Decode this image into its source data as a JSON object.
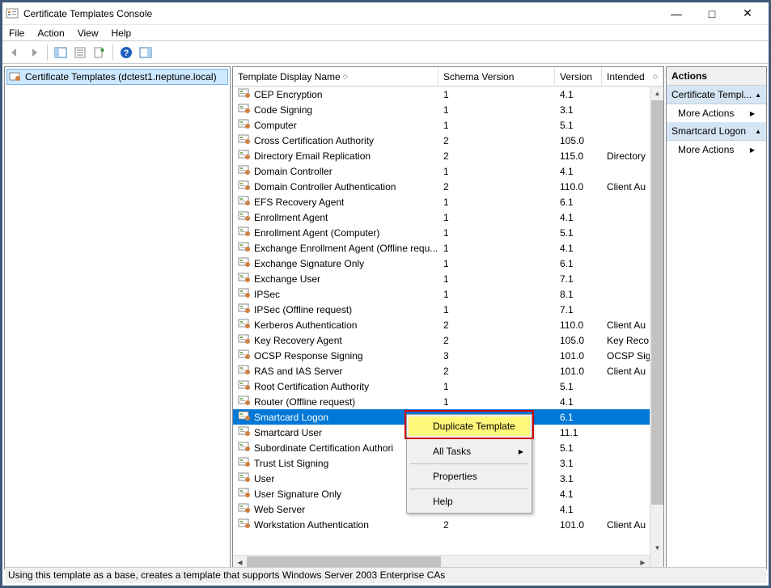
{
  "window": {
    "title": "Certificate Templates Console"
  },
  "menu": {
    "file": "File",
    "action": "Action",
    "view": "View",
    "help": "Help"
  },
  "tree": {
    "root": "Certificate Templates (dctest1.neptune.local)"
  },
  "columns": {
    "name": "Template Display Name",
    "schema": "Schema Version",
    "version": "Version",
    "intended": "Intended"
  },
  "rows": [
    {
      "name": "CEP Encryption",
      "schema": "1",
      "version": "4.1",
      "intended": ""
    },
    {
      "name": "Code Signing",
      "schema": "1",
      "version": "3.1",
      "intended": ""
    },
    {
      "name": "Computer",
      "schema": "1",
      "version": "5.1",
      "intended": ""
    },
    {
      "name": "Cross Certification Authority",
      "schema": "2",
      "version": "105.0",
      "intended": ""
    },
    {
      "name": "Directory Email Replication",
      "schema": "2",
      "version": "115.0",
      "intended": "Directory"
    },
    {
      "name": "Domain Controller",
      "schema": "1",
      "version": "4.1",
      "intended": ""
    },
    {
      "name": "Domain Controller Authentication",
      "schema": "2",
      "version": "110.0",
      "intended": "Client Au"
    },
    {
      "name": "EFS Recovery Agent",
      "schema": "1",
      "version": "6.1",
      "intended": ""
    },
    {
      "name": "Enrollment Agent",
      "schema": "1",
      "version": "4.1",
      "intended": ""
    },
    {
      "name": "Enrollment Agent (Computer)",
      "schema": "1",
      "version": "5.1",
      "intended": ""
    },
    {
      "name": "Exchange Enrollment Agent (Offline requ...",
      "schema": "1",
      "version": "4.1",
      "intended": ""
    },
    {
      "name": "Exchange Signature Only",
      "schema": "1",
      "version": "6.1",
      "intended": ""
    },
    {
      "name": "Exchange User",
      "schema": "1",
      "version": "7.1",
      "intended": ""
    },
    {
      "name": "IPSec",
      "schema": "1",
      "version": "8.1",
      "intended": ""
    },
    {
      "name": "IPSec (Offline request)",
      "schema": "1",
      "version": "7.1",
      "intended": ""
    },
    {
      "name": "Kerberos Authentication",
      "schema": "2",
      "version": "110.0",
      "intended": "Client Au"
    },
    {
      "name": "Key Recovery Agent",
      "schema": "2",
      "version": "105.0",
      "intended": "Key Reco"
    },
    {
      "name": "OCSP Response Signing",
      "schema": "3",
      "version": "101.0",
      "intended": "OCSP Sig"
    },
    {
      "name": "RAS and IAS Server",
      "schema": "2",
      "version": "101.0",
      "intended": "Client Au"
    },
    {
      "name": "Root Certification Authority",
      "schema": "1",
      "version": "5.1",
      "intended": ""
    },
    {
      "name": "Router (Offline request)",
      "schema": "1",
      "version": "4.1",
      "intended": ""
    },
    {
      "name": "Smartcard Logon",
      "schema": "",
      "version": "6.1",
      "intended": "",
      "selected": true
    },
    {
      "name": "Smartcard User",
      "schema": "",
      "version": "11.1",
      "intended": ""
    },
    {
      "name": "Subordinate Certification Authori",
      "schema": "",
      "version": "5.1",
      "intended": ""
    },
    {
      "name": "Trust List Signing",
      "schema": "",
      "version": "3.1",
      "intended": ""
    },
    {
      "name": "User",
      "schema": "",
      "version": "3.1",
      "intended": ""
    },
    {
      "name": "User Signature Only",
      "schema": "",
      "version": "4.1",
      "intended": ""
    },
    {
      "name": "Web Server",
      "schema": "1",
      "version": "4.1",
      "intended": ""
    },
    {
      "name": "Workstation Authentication",
      "schema": "2",
      "version": "101.0",
      "intended": "Client Au"
    }
  ],
  "context": {
    "duplicate": "Duplicate Template",
    "alltasks": "All Tasks",
    "properties": "Properties",
    "help": "Help"
  },
  "actions": {
    "header": "Actions",
    "sec1": "Certificate Templ...",
    "more": "More Actions",
    "sec2": "Smartcard Logon"
  },
  "status": "Using this template as a base, creates a template that supports Windows Server 2003 Enterprise CAs"
}
